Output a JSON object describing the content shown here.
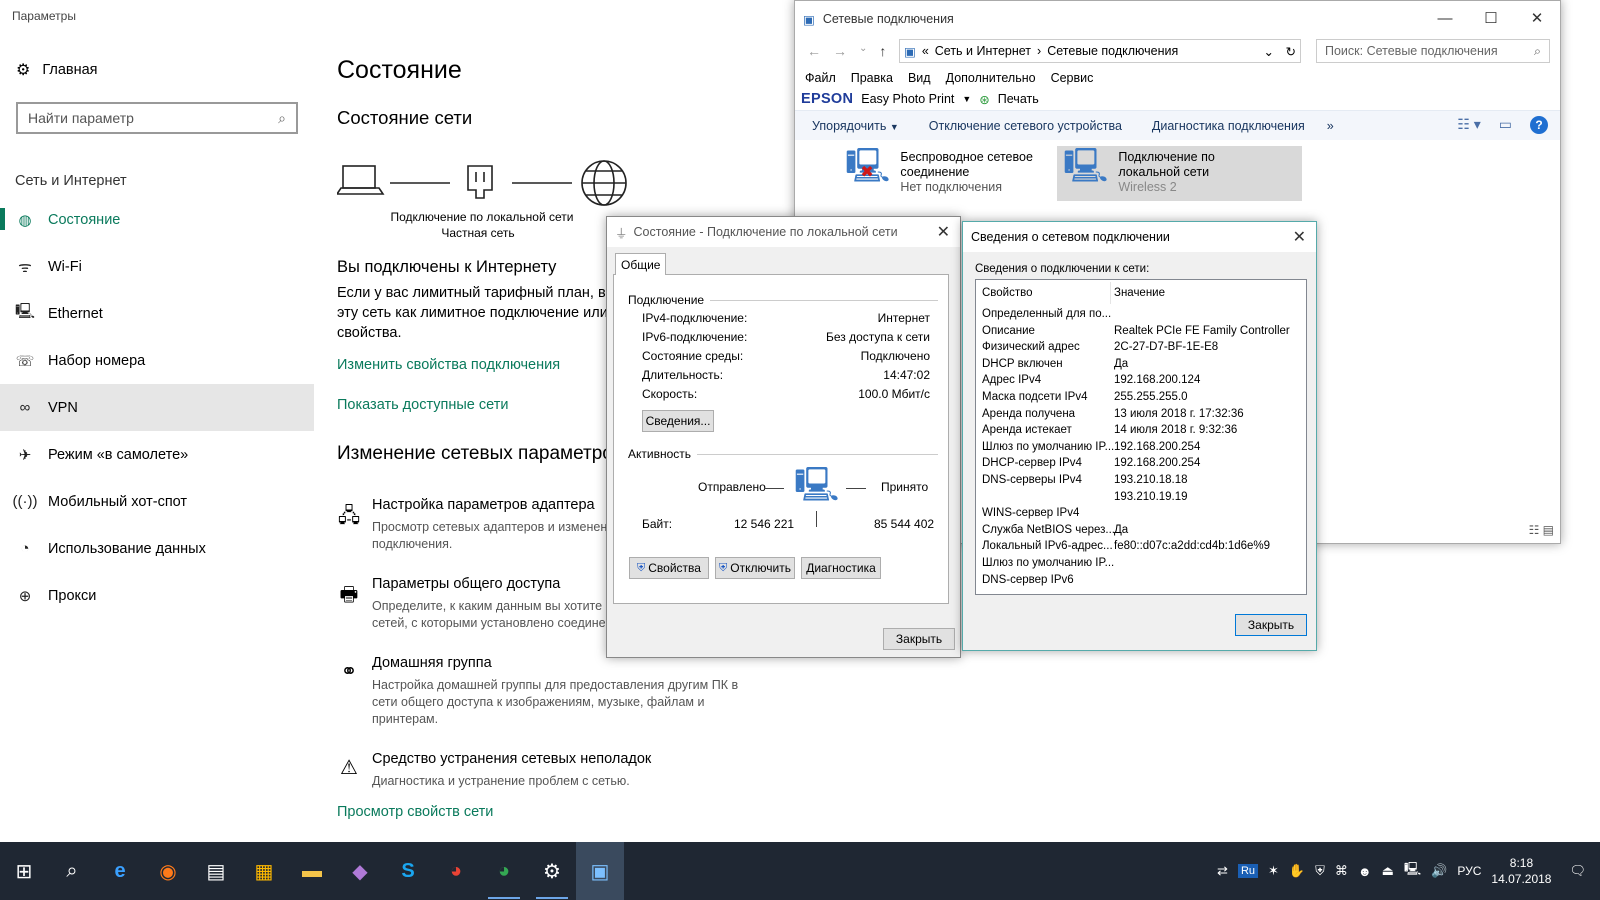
{
  "settings": {
    "window_title": "Параметры",
    "home": "Главная",
    "search_placeholder": "Найти параметр",
    "section": "Сеть и Интернет",
    "nav": [
      {
        "label": "Состояние",
        "icon": "globe-icon"
      },
      {
        "label": "Wi-Fi",
        "icon": "wifi-icon"
      },
      {
        "label": "Ethernet",
        "icon": "ethernet-icon"
      },
      {
        "label": "Набор номера",
        "icon": "dialup-icon"
      },
      {
        "label": "VPN",
        "icon": "vpn-icon"
      },
      {
        "label": "Режим «в самолете»",
        "icon": "airplane-icon"
      },
      {
        "label": "Мобильный хот-спот",
        "icon": "hotspot-icon"
      },
      {
        "label": "Использование данных",
        "icon": "data-usage-icon"
      },
      {
        "label": "Прокси",
        "icon": "proxy-globe-icon"
      }
    ],
    "main": {
      "title": "Состояние",
      "net_status": "Состояние сети",
      "conn_name": "Подключение по локальной сети",
      "conn_type": "Частная сеть",
      "connected": "Вы подключены к Интернету",
      "para_1": "Если у вас лимитный тарифный план, вы",
      "para_2": "эту сеть как лимитное подключение или",
      "para_3": "свойства.",
      "link_change": "Изменить свойства подключения",
      "link_show": "Показать доступные сети",
      "change_title": "Изменение сетевых параметров",
      "options": [
        {
          "title": "Настройка параметров адаптера",
          "d1": "Просмотр сетевых адаптеров и изменение",
          "d2": "подключения.",
          "d3": ""
        },
        {
          "title": "Параметры общего доступа",
          "d1": "Определите, к каким данным вы хотите",
          "d2": "сетей, с которыми установлено соедине",
          "d3": ""
        },
        {
          "title": "Домашняя группа",
          "d1": "Настройка домашней группы для предоставления другим ПК в",
          "d2": "сети общего доступа к изображениям, музыке, файлам и",
          "d3": "принтерам."
        },
        {
          "title": "Средство устранения сетевых неполадок",
          "d1": "Диагностика и устранение проблем с сетью.",
          "d2": "",
          "d3": ""
        }
      ],
      "link_view": "Просмотр свойств сети"
    }
  },
  "explorer": {
    "title": "Сетевые подключения",
    "path_prefix": "«",
    "path_1": "Сеть и Интернет",
    "path_2": "Сетевые подключения",
    "search_placeholder": "Поиск: Сетевые подключения",
    "menu": [
      "Файл",
      "Правка",
      "Вид",
      "Дополнительно",
      "Сервис"
    ],
    "epson_brand": "EPSON",
    "epson_app": "Easy Photo Print",
    "epson_print": "Печать",
    "toolbar": [
      "Упорядочить",
      "Отключение сетевого устройства",
      "Диагностика подключения",
      "»"
    ],
    "items": [
      {
        "l1": "Беспроводное сетевое",
        "l2": "соединение",
        "l3": "Нет подключения"
      },
      {
        "l1": "Подключение по",
        "l2": "локальной сети",
        "l3": "Wireless  2"
      }
    ]
  },
  "status_dialog": {
    "title": "Состояние - Подключение по локальной сети",
    "tab": "Общие",
    "group_connection": "Подключение",
    "rows": [
      {
        "k": "IPv4-подключение:",
        "v": "Интернет"
      },
      {
        "k": "IPv6-подключение:",
        "v": "Без доступа к сети"
      },
      {
        "k": "Состояние среды:",
        "v": "Подключено"
      },
      {
        "k": "Длительность:",
        "v": "14:47:02"
      },
      {
        "k": "Скорость:",
        "v": "100.0 Мбит/с"
      }
    ],
    "details_btn": "Сведения...",
    "group_activity": "Активность",
    "sent_label": "Отправлено",
    "recv_label": "Принято",
    "bytes_label": "Байт:",
    "bytes_sent": "12 546 221",
    "bytes_recv": "85 544 402",
    "btn_props": "Свойства",
    "btn_disable": "Отключить",
    "btn_diag": "Диагностика",
    "btn_close": "Закрыть"
  },
  "details_dialog": {
    "title": "Сведения о сетевом подключении",
    "subtitle": "Сведения о подключении к сети:",
    "col_prop": "Свойство",
    "col_val": "Значение",
    "rows": [
      {
        "k": "Определенный для по...",
        "v": ""
      },
      {
        "k": "Описание",
        "v": "Realtek PCIe FE Family Controller"
      },
      {
        "k": "Физический адрес",
        "v": "2C-27-D7-BF-1E-E8"
      },
      {
        "k": "DHCP включен",
        "v": "Да"
      },
      {
        "k": "Адрес IPv4",
        "v": "192.168.200.124"
      },
      {
        "k": "Маска подсети IPv4",
        "v": "255.255.255.0"
      },
      {
        "k": "Аренда получена",
        "v": "13 июля 2018 г. 17:32:36"
      },
      {
        "k": "Аренда истекает",
        "v": "14 июля 2018 г. 9:32:36"
      },
      {
        "k": "Шлюз по умолчанию IP...",
        "v": "192.168.200.254"
      },
      {
        "k": "DHCP-сервер IPv4",
        "v": "192.168.200.254"
      },
      {
        "k": "DNS-серверы IPv4",
        "v": "193.210.18.18"
      },
      {
        "k": "",
        "v": "193.210.19.19"
      },
      {
        "k": "WINS-сервер IPv4",
        "v": ""
      },
      {
        "k": "Служба NetBIOS через...",
        "v": "Да"
      },
      {
        "k": "Локальный IPv6-адрес...",
        "v": "fe80::d07c:a2dd:cd4b:1d6e%9"
      },
      {
        "k": "Шлюз по умолчанию IP...",
        "v": ""
      },
      {
        "k": "DNS-сервер IPv6",
        "v": ""
      }
    ],
    "btn_close": "Закрыть"
  },
  "taskbar": {
    "lang": "РУС",
    "time": "8:18",
    "date": "14.07.2018",
    "ru_badge": "Ru"
  },
  "colors": {
    "accent": "#0a7a5c",
    "taskbar": "#1f2733",
    "link": "#0a7a5c"
  }
}
